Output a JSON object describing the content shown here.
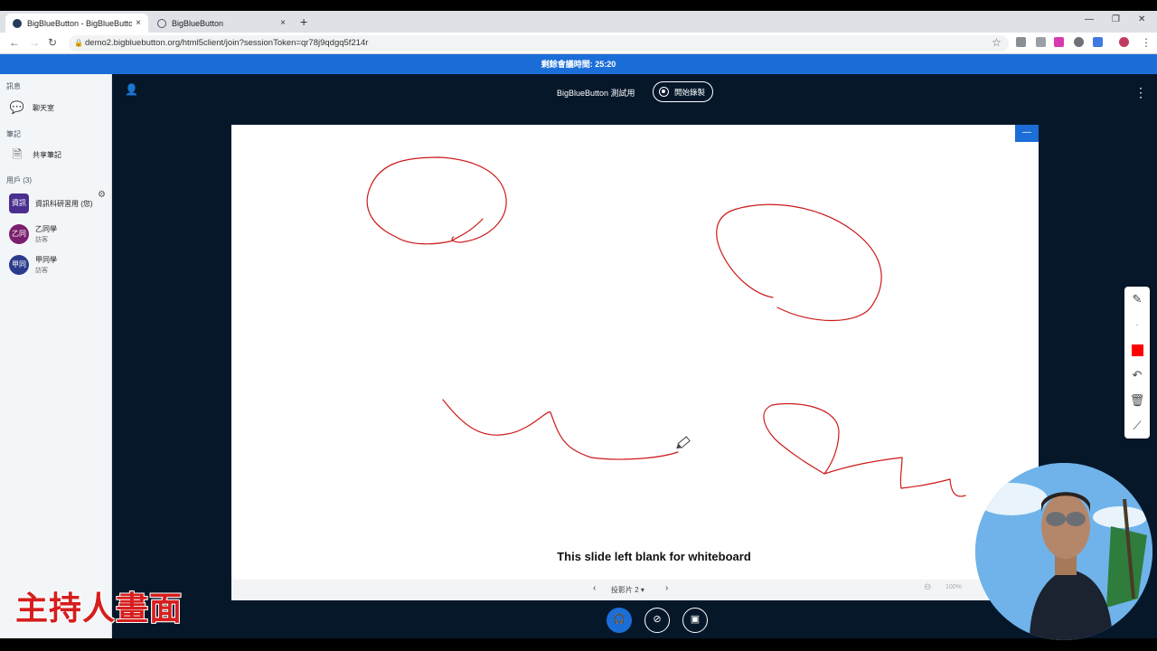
{
  "browser": {
    "tabs": [
      {
        "title": "BigBlueButton - BigBlueButton",
        "close": "×"
      },
      {
        "title": "BigBlueButton",
        "close": "×"
      }
    ],
    "new_tab": "+",
    "url": "demo2.bigbluebutton.org/html5client/join?sessionToken=qr78j9qdgq5f214r"
  },
  "banner": {
    "text": "剩餘會議時間: 25:20"
  },
  "sidebar": {
    "messages_title": "訊息",
    "chat_label": "聊天室",
    "notes_title": "筆記",
    "shared_notes_label": "共享筆記",
    "users_title": "用戶 (3)",
    "users": [
      {
        "avatar": "資訊",
        "name": "資訊科研習用 (您)",
        "role": "",
        "color": "#4a2f8f"
      },
      {
        "avatar": "乙同",
        "name": "乙同學",
        "role": "訪客",
        "color": "#7a1f6e"
      },
      {
        "avatar": "甲同",
        "name": "甲同學",
        "role": "訪客",
        "color": "#2a3a8c"
      }
    ]
  },
  "topbar": {
    "meeting_name": "BigBlueButton 測試用",
    "record_label": "開始錄製"
  },
  "whiteboard": {
    "caption": "This slide left blank for whiteboard",
    "slide_label": "投影片 2",
    "zoom": "100%",
    "color": "#ff0000",
    "stroke_color": "#cc1a1a"
  },
  "overlay_text": "主持人畫面",
  "icons": {
    "user_list": "user-icon",
    "chat": "chat-icon",
    "notes": "notes-icon",
    "settings": "gear-icon",
    "pencil": "pencil-icon",
    "undo": "undo-icon",
    "trash": "trash-icon",
    "multiuser": "whiteboard-multiuser-icon",
    "audio": "headset-icon",
    "camera": "camera-off-icon",
    "screenshare": "screenshare-off-icon"
  }
}
